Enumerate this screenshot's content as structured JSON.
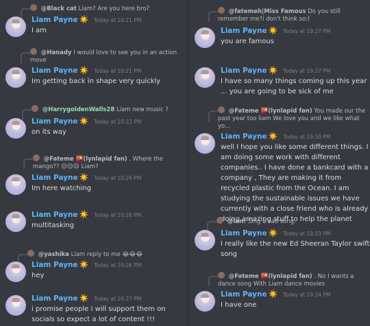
{
  "left": [
    {
      "reply": {
        "user": "@Black cat",
        "text": "Liam? Are you here bro?"
      },
      "author": "Liam Payne",
      "ts": "Today at 10:21 PM",
      "text": "I am"
    },
    {
      "reply": {
        "user": "@Hanady",
        "text": "I would love to see you in an action move"
      },
      "author": "Liam Payne",
      "ts": "Today at 10:21 PM",
      "text": "Im getting back in shape very quickly"
    },
    {
      "reply": {
        "user": "@HarrygoldenWalls28",
        "text": "Liam new music ?"
      },
      "author": "Liam Payne",
      "ts": "Today at 10:22 PM",
      "text": "on its way"
    },
    {
      "reply": {
        "user": "@Fateme 🌇(lynlapid fan)",
        "text": ". Where the mango?? 😔😔😔 Liam?"
      },
      "author": "Liam Payne",
      "ts": "Today at 10:26 PM",
      "text": "Im here watching"
    },
    {
      "reply": null,
      "author": "Liam Payne",
      "ts": "Today at 10:26 PM",
      "text": "multitasking"
    },
    {
      "reply": {
        "user": "@yashika",
        "text": "Liam reply to me 😂😂😂"
      },
      "author": "Liam Payne",
      "ts": "Today at 10:26 PM",
      "text": "hey"
    },
    {
      "reply": null,
      "author": "Liam Payne",
      "ts": "Today at 10:27 PM",
      "text": "i promise people I will support them on socials so expect a lot of content !!!"
    }
  ],
  "right": [
    {
      "reply": {
        "user": "@fatemeh|Miss Famous",
        "text": "Do you still remember me?i don't think so:("
      },
      "author": "Liam Payne",
      "ts": "Today at 10:27 PM",
      "text": "you are famous"
    },
    {
      "reply": null,
      "author": "Liam Payne",
      "ts": "Today at 10:27 PM",
      "text": "I have so many things coming up this year ... you are going to be sick of me"
    },
    {
      "reply": {
        "user": "@Fateme 🌇(lynlapid fan)",
        "text": "You made our the past year too liam  We love you and we like what yo..."
      },
      "author": "Liam Payne",
      "ts": "Today at 10:30 PM",
      "text": "well I hope you like some different things. I am doing some work with different companies.. I have done a bankcard with a company , They are making it from recycled plastic from the Ocean. I am studying the sustainable issues we have currently with a close friend who is already doing amazing stuff to help the planet"
    },
    {
      "reply": {
        "user": "@Ian!",
        "text": "Sing a sad song."
      },
      "author": "Liam Payne",
      "ts": "Today at 10:33 PM",
      "text": "I really like the new Ed Sheeran Taylor swift song"
    },
    {
      "reply": {
        "user": "@Fateme 🌇(lynlapid fan)",
        "text": ". No I wants a dance song With Liam dance movies"
      },
      "author": "Liam Payne",
      "ts": "Today at 10:34 PM",
      "text": "I have one"
    }
  ],
  "icons": {
    "sun": "☀️",
    "reply_avatar": "mini-avatar"
  }
}
